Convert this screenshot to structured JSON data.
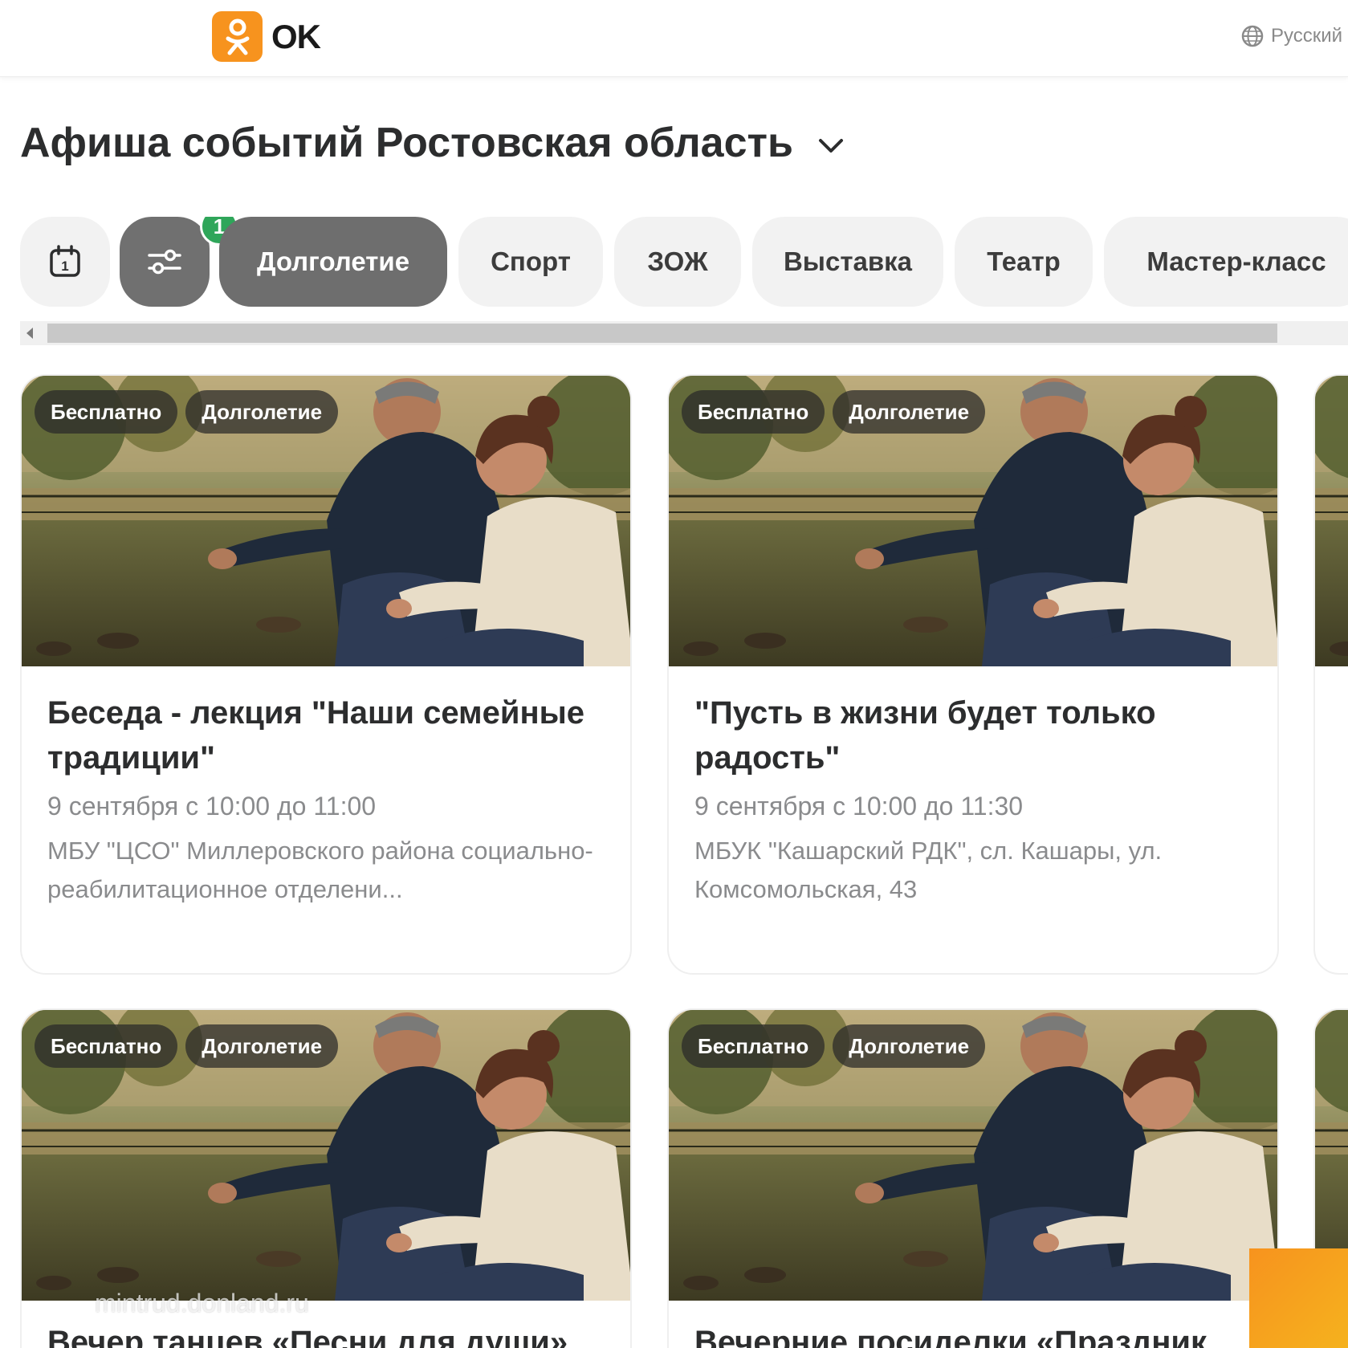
{
  "header": {
    "logo_text": "OK",
    "language": "Русский"
  },
  "page": {
    "title": "Афиша событий Ростовская область"
  },
  "filters": {
    "badge_count": "1",
    "chips": [
      {
        "label": "Долголетие",
        "active": true
      },
      {
        "label": "Спорт",
        "active": false
      },
      {
        "label": "ЗОЖ",
        "active": false
      },
      {
        "label": "Выставка",
        "active": false
      },
      {
        "label": "Театр",
        "active": false
      },
      {
        "label": "Мастер-класс",
        "active": false
      }
    ]
  },
  "events": [
    {
      "tags": [
        "Бесплатно",
        "Долголетие"
      ],
      "title": "Беседа - лекция \"Наши семейные традиции\"",
      "date": "9 сентября с 10:00 до 11:00",
      "place": "МБУ \"ЦСО\" Миллеровского района социально-реабилитационное отделени..."
    },
    {
      "tags": [
        "Бесплатно",
        "Долголетие"
      ],
      "title": "\"Пусть в жизни будет только радость\"",
      "date": "9 сентября с 10:00 до 11:30",
      "place": "МБУК \"Кашарский РДК\", сл. Кашары, ул. Комсомольская, 43"
    },
    {
      "tags": [
        "Бесплатно",
        "Долголетие"
      ],
      "title": "Вечер танцев «Песни для души»",
      "date": "",
      "place": ""
    },
    {
      "tags": [
        "Бесплатно",
        "Долголетие"
      ],
      "title": "Вечерние посиделки «Праздник",
      "date": "",
      "place": ""
    }
  ],
  "watermark": "mintrud.donland.ru",
  "colors": {
    "brand": "#f7931e",
    "active_chip": "#6e6e6e",
    "badge": "#2fa65a"
  }
}
